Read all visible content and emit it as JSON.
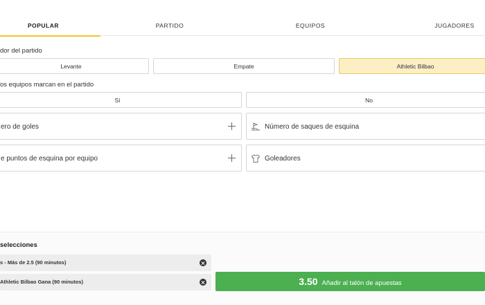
{
  "tabs": [
    {
      "label": "POPULAR",
      "active": true
    },
    {
      "label": "PARTIDO",
      "active": false
    },
    {
      "label": "EQUIPOS",
      "active": false
    },
    {
      "label": "JUGADORES",
      "active": false
    }
  ],
  "match_winner": {
    "title": "dor del partido",
    "options": [
      "Levante",
      "Empate",
      "Athletic Bilbao"
    ],
    "selected": "Athletic Bilbao"
  },
  "both_score": {
    "title": "os equipos marcan en el partido",
    "options": [
      "Sí",
      "No"
    ]
  },
  "markets": [
    {
      "label": "ero de goles",
      "icon": "plus-icon"
    },
    {
      "label": "Número de saques de esquina",
      "icon": "corner-flag-icon"
    },
    {
      "label": "e puntos de esquina por equipo",
      "icon": "plus-icon"
    },
    {
      "label": "Goleadores",
      "icon": "jersey-icon"
    }
  ],
  "betslip": {
    "title": "selecciones",
    "selections": [
      "s - Más de 2.5 (90 minutos)",
      "Athletic Bilbao Gana (90 minutos)"
    ],
    "odds": "3.50",
    "add_label": "Añadir al talón de apuestas"
  },
  "colors": {
    "accent": "#f2c230",
    "selected_bg": "#fcefc4",
    "add_button": "#4caf50"
  }
}
